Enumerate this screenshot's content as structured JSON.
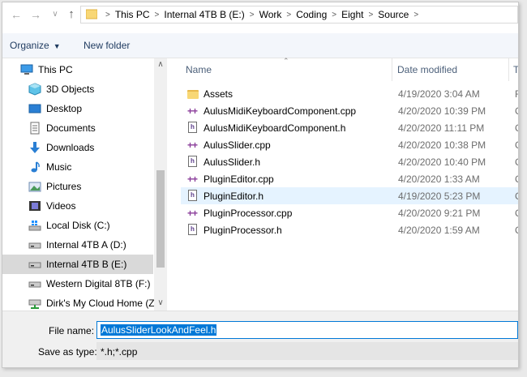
{
  "nav": {
    "back_glyph": "←",
    "forward_glyph": "→",
    "history_glyph": "∨",
    "up_glyph": "↑"
  },
  "breadcrumb": [
    "This PC",
    "Internal 4TB B (E:)",
    "Work",
    "Coding",
    "Eight",
    "Source"
  ],
  "toolbar": {
    "organize_label": "Organize",
    "new_folder_label": "New folder"
  },
  "sidebar": {
    "items": [
      {
        "label": "This PC",
        "icon": "computer-icon"
      },
      {
        "label": "3D Objects",
        "icon": "3d-objects-icon"
      },
      {
        "label": "Desktop",
        "icon": "desktop-icon"
      },
      {
        "label": "Documents",
        "icon": "documents-icon"
      },
      {
        "label": "Downloads",
        "icon": "downloads-icon"
      },
      {
        "label": "Music",
        "icon": "music-icon"
      },
      {
        "label": "Pictures",
        "icon": "pictures-icon"
      },
      {
        "label": "Videos",
        "icon": "videos-icon"
      },
      {
        "label": "Local Disk (C:)",
        "icon": "windows-drive-icon"
      },
      {
        "label": "Internal 4TB A (D:)",
        "icon": "drive-icon"
      },
      {
        "label": "Internal 4TB B (E:)",
        "icon": "drive-icon"
      },
      {
        "label": "Western Digital 8TB (F:)",
        "icon": "drive-icon"
      },
      {
        "label": "Dirk's My Cloud Home (Z",
        "icon": "network-drive-icon"
      }
    ],
    "selected_index": 10
  },
  "columns": {
    "name": "Name",
    "date": "Date modified",
    "type": "T"
  },
  "files": [
    {
      "name": "Assets",
      "date": "4/19/2020 3:04 AM",
      "type": "F",
      "kind": "folder"
    },
    {
      "name": "AulusMidiKeyboardComponent.cpp",
      "date": "4/20/2020 10:39 PM",
      "type": "C",
      "kind": "cpp"
    },
    {
      "name": "AulusMidiKeyboardComponent.h",
      "date": "4/20/2020 11:11 PM",
      "type": "C",
      "kind": "h"
    },
    {
      "name": "AulusSlider.cpp",
      "date": "4/20/2020 10:38 PM",
      "type": "C",
      "kind": "cpp"
    },
    {
      "name": "AulusSlider.h",
      "date": "4/20/2020 10:40 PM",
      "type": "C",
      "kind": "h"
    },
    {
      "name": "PluginEditor.cpp",
      "date": "4/20/2020 1:33 AM",
      "type": "C",
      "kind": "cpp"
    },
    {
      "name": "PluginEditor.h",
      "date": "4/19/2020 5:23 PM",
      "type": "C",
      "kind": "h"
    },
    {
      "name": "PluginProcessor.cpp",
      "date": "4/20/2020 9:21 PM",
      "type": "C",
      "kind": "cpp"
    },
    {
      "name": "PluginProcessor.h",
      "date": "4/20/2020 1:59 AM",
      "type": "C",
      "kind": "h"
    }
  ],
  "hover_index": 6,
  "save": {
    "file_name_label": "File name:",
    "file_name_value": "AulusSliderLookAndFeel.h",
    "save_type_label": "Save as type:",
    "save_type_value": "*.h;*.cpp"
  },
  "colors": {
    "accent": "#0078d7",
    "hover": "#e5f3ff",
    "selected": "#d9d9d9"
  }
}
